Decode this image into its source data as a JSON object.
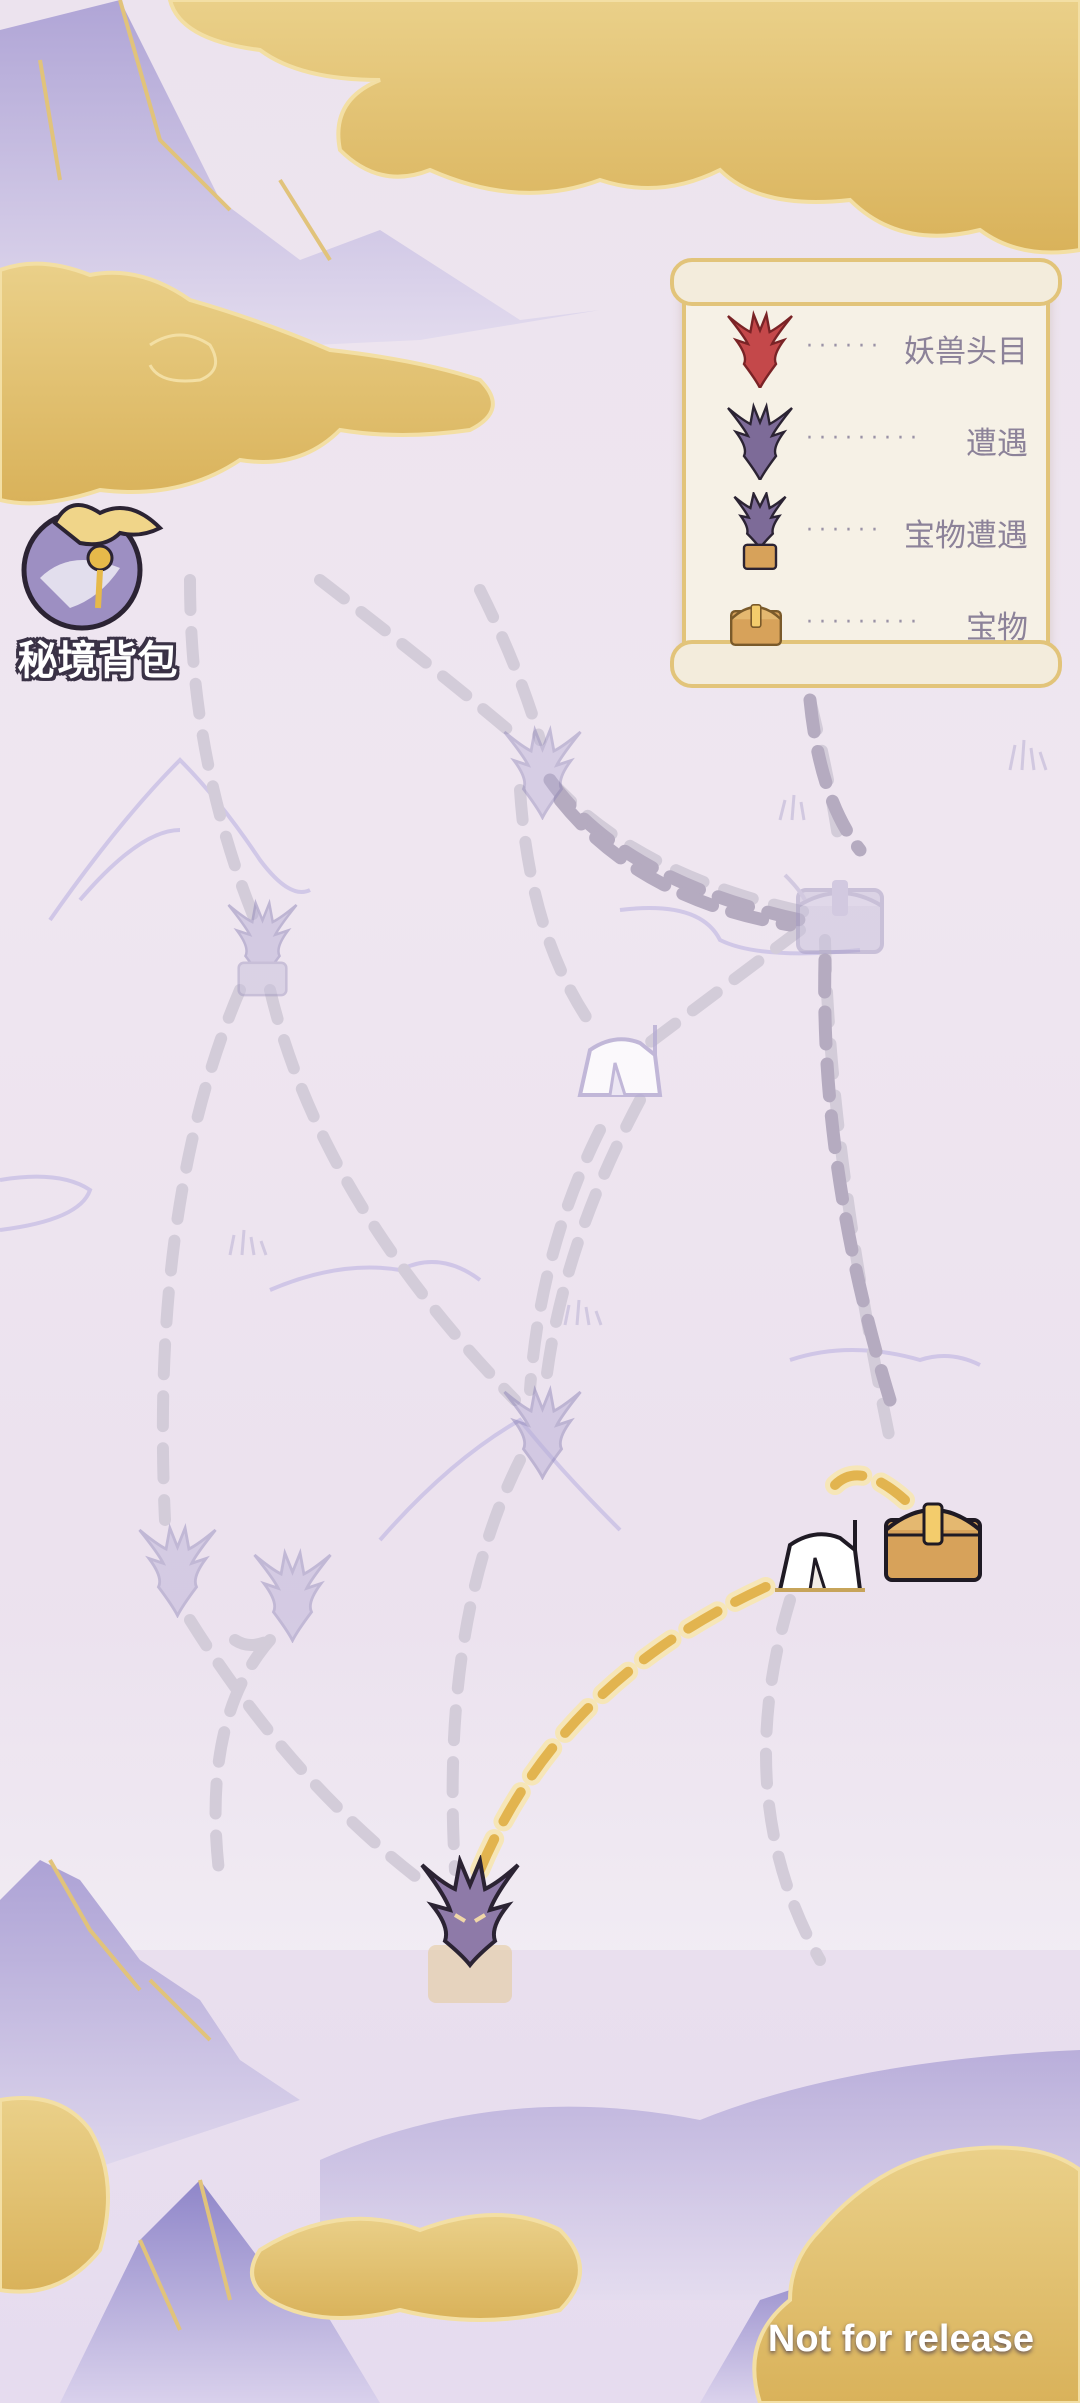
{
  "legend": {
    "items": [
      {
        "icon": "red-beast-head-icon",
        "dots": "······",
        "label": "妖兽头目"
      },
      {
        "icon": "purple-beast-head-icon",
        "dots": "·········",
        "label": "遭遇"
      },
      {
        "icon": "beast-with-chest-icon",
        "dots": "······",
        "label": "宝物遭遇"
      },
      {
        "icon": "treasure-chest-icon",
        "dots": "·········",
        "label": "宝物"
      }
    ]
  },
  "inventory": {
    "label": "秘境背包",
    "icon": "treasure-bag-icon"
  },
  "map": {
    "nodes": [
      {
        "id": "n-top-beast",
        "type": "encounter",
        "state": "locked"
      },
      {
        "id": "n-top-right-chest",
        "type": "treasure-encounter",
        "state": "locked"
      },
      {
        "id": "n-left-beast-chest",
        "type": "treasure-encounter",
        "state": "locked"
      },
      {
        "id": "n-mid-tent",
        "type": "camp",
        "state": "locked"
      },
      {
        "id": "n-center-beast",
        "type": "encounter",
        "state": "locked"
      },
      {
        "id": "n-left-beast-1",
        "type": "encounter",
        "state": "locked"
      },
      {
        "id": "n-left-beast-2",
        "type": "encounter",
        "state": "locked"
      },
      {
        "id": "n-right-tent",
        "type": "camp",
        "state": "available"
      },
      {
        "id": "n-right-chest",
        "type": "treasure",
        "state": "available"
      },
      {
        "id": "n-current",
        "type": "treasure-encounter",
        "state": "current"
      }
    ],
    "colors": {
      "path_active": "#e2b44f",
      "path_inactive": "#d3ccd9",
      "gold": "#dcb55e",
      "mountain": "#b3a8d6"
    }
  },
  "watermark": "Not for release"
}
